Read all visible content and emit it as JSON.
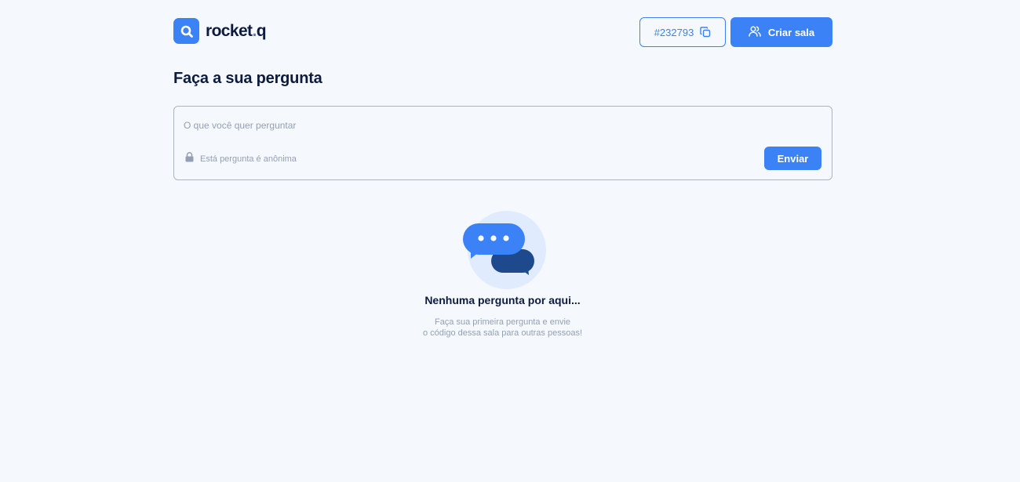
{
  "header": {
    "logo_text": "rocket",
    "logo_dot": ".",
    "logo_suffix": "q",
    "room_code": "#232793",
    "create_room_label": "Criar sala"
  },
  "page_title": "Faça a sua pergunta",
  "question_form": {
    "placeholder": "O que você quer perguntar",
    "anonymous_note": "Está pergunta é anônima",
    "send_label": "Enviar"
  },
  "empty_state": {
    "title": "Nenhuma pergunta por aqui...",
    "description_line1": "Faça sua primeira pergunta e envie",
    "description_line2": "o código dessa sala para outras pessoas!"
  },
  "colors": {
    "background": "#f5f9fe",
    "accent": "#3b82f6",
    "dark_text": "#0d1b3e",
    "muted_text": "#93a0b4",
    "dark_bubble": "#1e4a8d",
    "illustration_bg": "#e0ecfd"
  },
  "icons": {
    "logo": "search-logo-icon",
    "copy": "copy-icon",
    "users": "users-icon",
    "lock": "lock-icon",
    "chat": "chat-bubbles-icon"
  }
}
